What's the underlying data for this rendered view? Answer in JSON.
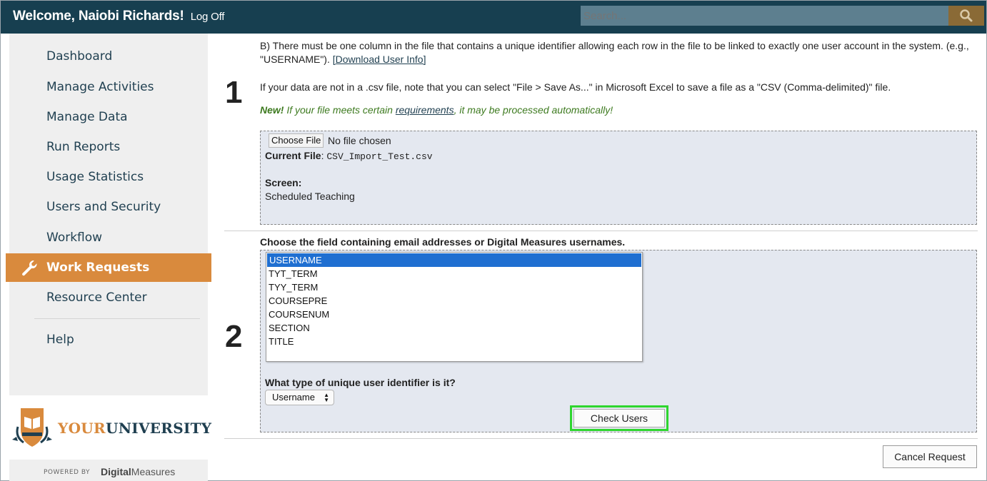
{
  "header": {
    "welcome": "Welcome, Naiobi Richards!",
    "logoff": "Log Off",
    "search_placeholder": "Search..."
  },
  "sidebar": {
    "items": [
      {
        "label": "Dashboard"
      },
      {
        "label": "Manage Activities"
      },
      {
        "label": "Manage Data"
      },
      {
        "label": "Run Reports"
      },
      {
        "label": "Usage Statistics"
      },
      {
        "label": "Users and Security"
      },
      {
        "label": "Workflow"
      },
      {
        "label": "Work Requests"
      },
      {
        "label": "Resource Center"
      },
      {
        "label": "Help"
      }
    ],
    "active_index": 7
  },
  "brand": {
    "your": "YOUR",
    "university": "UNIVERSITY",
    "powered_by": "POWERED BY",
    "dm_a": "Digital",
    "dm_b": "Measures"
  },
  "step1": {
    "number": "1",
    "para_b_text": "B) There must be one column in the file that contains a unique identifier allowing each row in the file to be linked to exactly one user account in the system. (e.g., \"USERNAME\"). ",
    "para_b_link": "[Download User Info]",
    "csv_text": "If your data are not in a .csv file, note that you can select \"File > Save As...\" in Microsoft Excel to save a file as a \"CSV (Comma-delimited)\" file.",
    "new_label": "New!",
    "new_text_a": " If your file meets certain ",
    "new_link": "requirements",
    "new_text_b": ", it may be processed automatically!",
    "choose_file": "Choose File",
    "no_file": "No file chosen",
    "current_file_label": "Current File",
    "current_file_value": "CSV_Import_Test.csv",
    "screen_label": "Screen:",
    "screen_value": "Scheduled Teaching"
  },
  "step2": {
    "number": "2",
    "heading": "Choose the field containing email addresses or Digital Measures usernames.",
    "fields": [
      "USERNAME",
      "TYT_TERM",
      "TYY_TERM",
      "COURSEPRE",
      "COURSENUM",
      "SECTION",
      "TITLE"
    ],
    "selected_field": "USERNAME",
    "type_question": "What type of unique user identifier is it?",
    "type_value": "Username",
    "check_users": "Check Users"
  },
  "cancel_request": "Cancel Request",
  "colors": {
    "header_bg": "#173f50",
    "accent": "#d98a3d",
    "highlight": "#2fd62f",
    "selection": "#1f6fd1"
  }
}
